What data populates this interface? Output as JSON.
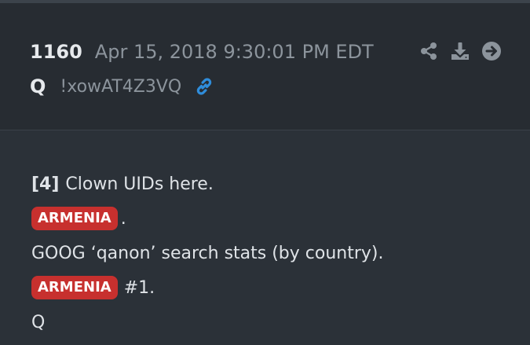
{
  "post": {
    "number": "1160",
    "date": "Apr 15, 2018 9:30:01 PM EDT",
    "author": "Q",
    "tripcode": "!xowAT4Z3VQ"
  },
  "icons": {
    "link": "link-icon",
    "share": "share-icon",
    "download": "download-icon",
    "next": "arrow-right-circle-icon"
  },
  "colors": {
    "header_bg": "#272c32",
    "body_bg": "#2b3138",
    "tag_bg": "#c7302e",
    "link_blue": "#2f8ddb",
    "muted_text": "#8c949c"
  },
  "content": {
    "line1_ref": "[4]",
    "line1_text": "Clown UIDs here.",
    "line2_tag": "ARMENIA",
    "line2_text": ".",
    "line3_text": "GOOG ‘qanon’ search stats (by country).",
    "line4_tag": "ARMENIA",
    "line4_text": "#1.",
    "line5_text": "Q"
  }
}
